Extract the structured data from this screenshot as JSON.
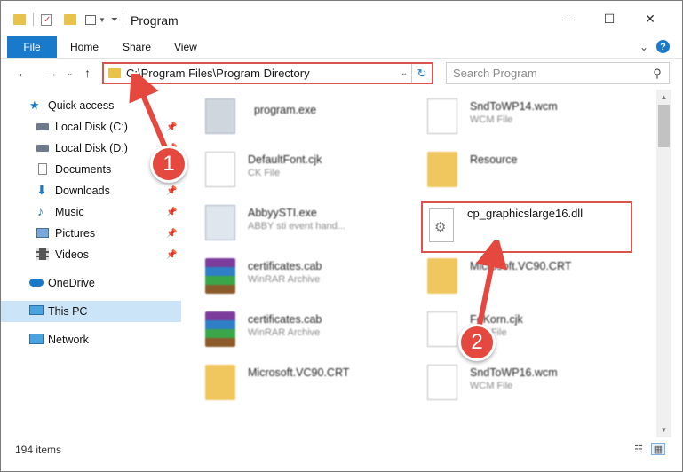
{
  "window": {
    "title": "Program",
    "controls": {
      "minimize": "—",
      "maximize": "☐",
      "close": "✕"
    }
  },
  "ribbon": {
    "file": "File",
    "tabs": [
      "Home",
      "Share",
      "View"
    ],
    "help": "?"
  },
  "nav": {
    "address": "C:\\Program Files\\Program Directory",
    "search_placeholder": "Search Program"
  },
  "sidebar": {
    "items": [
      {
        "label": "Quick access",
        "icon": "star-icon"
      },
      {
        "label": "Local Disk (C:)",
        "icon": "drive-icon",
        "pinned": true
      },
      {
        "label": "Local Disk (D:)",
        "icon": "drive-icon",
        "pinned": true
      },
      {
        "label": "Documents",
        "icon": "documents-icon",
        "pinned": true
      },
      {
        "label": "Downloads",
        "icon": "downloads-icon",
        "pinned": true
      },
      {
        "label": "Music",
        "icon": "music-icon",
        "pinned": true
      },
      {
        "label": "Pictures",
        "icon": "pictures-icon",
        "pinned": true
      },
      {
        "label": "Videos",
        "icon": "videos-icon",
        "pinned": true
      },
      {
        "label": "OneDrive",
        "icon": "onedrive-icon"
      },
      {
        "label": "This PC",
        "icon": "computer-icon",
        "selected": true
      },
      {
        "label": "Network",
        "icon": "network-icon"
      }
    ]
  },
  "files": [
    {
      "name": "program.exe",
      "sub": "",
      "icon": "exe-icon"
    },
    {
      "name": "SndToWP14.wcm",
      "sub": "WCM File",
      "icon": "document-icon"
    },
    {
      "name": "DefaultFont.cjk",
      "sub": "CK File",
      "icon": "document-icon"
    },
    {
      "name": "Resource",
      "sub": "",
      "icon": "folder-icon"
    },
    {
      "name": "AbbyySTI.exe",
      "sub": "ABBY sti event hand...",
      "icon": "exe-icon"
    },
    {
      "name": "certificates.cab",
      "sub": "WinRAR Archive",
      "icon": "archive-icon"
    },
    {
      "name": "Microsoft.VC90.CRT",
      "sub": "",
      "icon": "folder-icon"
    },
    {
      "name": "certificates.cab",
      "sub": "WinRAR Archive",
      "icon": "archive-icon"
    },
    {
      "name": "FeKorn.cjk",
      "sub": "CJK File",
      "icon": "document-icon"
    },
    {
      "name": "Microsoft.VC90.CRT",
      "sub": "",
      "icon": "folder-icon"
    },
    {
      "name": "SndToWP16.wcm",
      "sub": "WCM File",
      "icon": "document-icon"
    }
  ],
  "highlighted_file": {
    "name": "cp_graphicslarge16.dll",
    "icon": "dll-gear-icon"
  },
  "status": {
    "items": "194 items"
  },
  "markers": [
    "1",
    "2"
  ],
  "colors": {
    "accent": "#1979ca",
    "highlight": "#d9534f",
    "marker": "#e5483e",
    "selected": "#cce4f7"
  }
}
